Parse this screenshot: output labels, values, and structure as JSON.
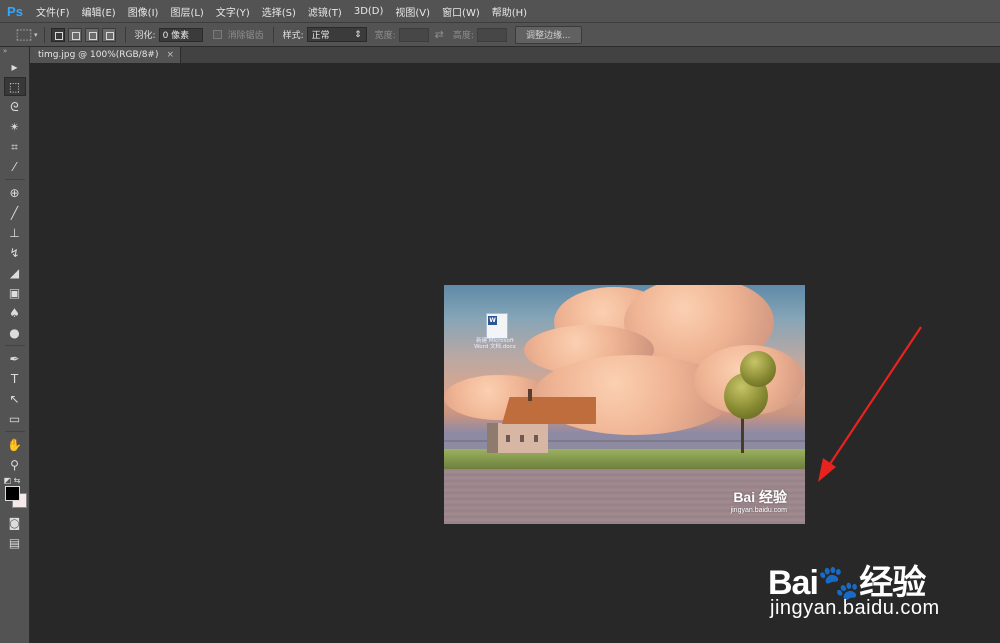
{
  "app": {
    "logo": "Ps"
  },
  "menu": [
    "文件(F)",
    "编辑(E)",
    "图像(I)",
    "图层(L)",
    "文字(Y)",
    "选择(S)",
    "滤镜(T)",
    "3D(D)",
    "视图(V)",
    "窗口(W)",
    "帮助(H)"
  ],
  "options": {
    "feather_label": "羽化:",
    "feather_value": "0 像素",
    "antialias_label": "消除锯齿",
    "style_label": "样式:",
    "style_value": "正常",
    "width_label": "宽度:",
    "height_label": "高度:",
    "refine_edge": "调整边缘..."
  },
  "document": {
    "tab_title": "timg.jpg @ 100%(RGB/8#)",
    "close_glyph": "×"
  },
  "photo": {
    "desktop_icon_label": "新建 Microsoft Word 文档.docx",
    "watermark_logo": "Bai 经验",
    "watermark_url": "jingyan.baidu.com"
  },
  "overlay_watermark": {
    "logo_prefix": "Bai",
    "logo_suffix": "经验",
    "url": "jingyan.baidu.com"
  },
  "colors": {
    "annotation_arrow": "#e8231f",
    "foreground": "#000000",
    "background": "#f6e9ea"
  },
  "tools": [
    "move-icon",
    "marquee-icon",
    "lasso-icon",
    "magic-wand-icon",
    "crop-icon",
    "eyedropper-icon",
    "healing-brush-icon",
    "brush-icon",
    "clone-stamp-icon",
    "history-brush-icon",
    "eraser-icon",
    "gradient-icon",
    "blur-icon",
    "dodge-icon",
    "pen-icon",
    "type-icon",
    "path-selection-icon",
    "rectangle-icon",
    "hand-icon",
    "zoom-icon"
  ]
}
